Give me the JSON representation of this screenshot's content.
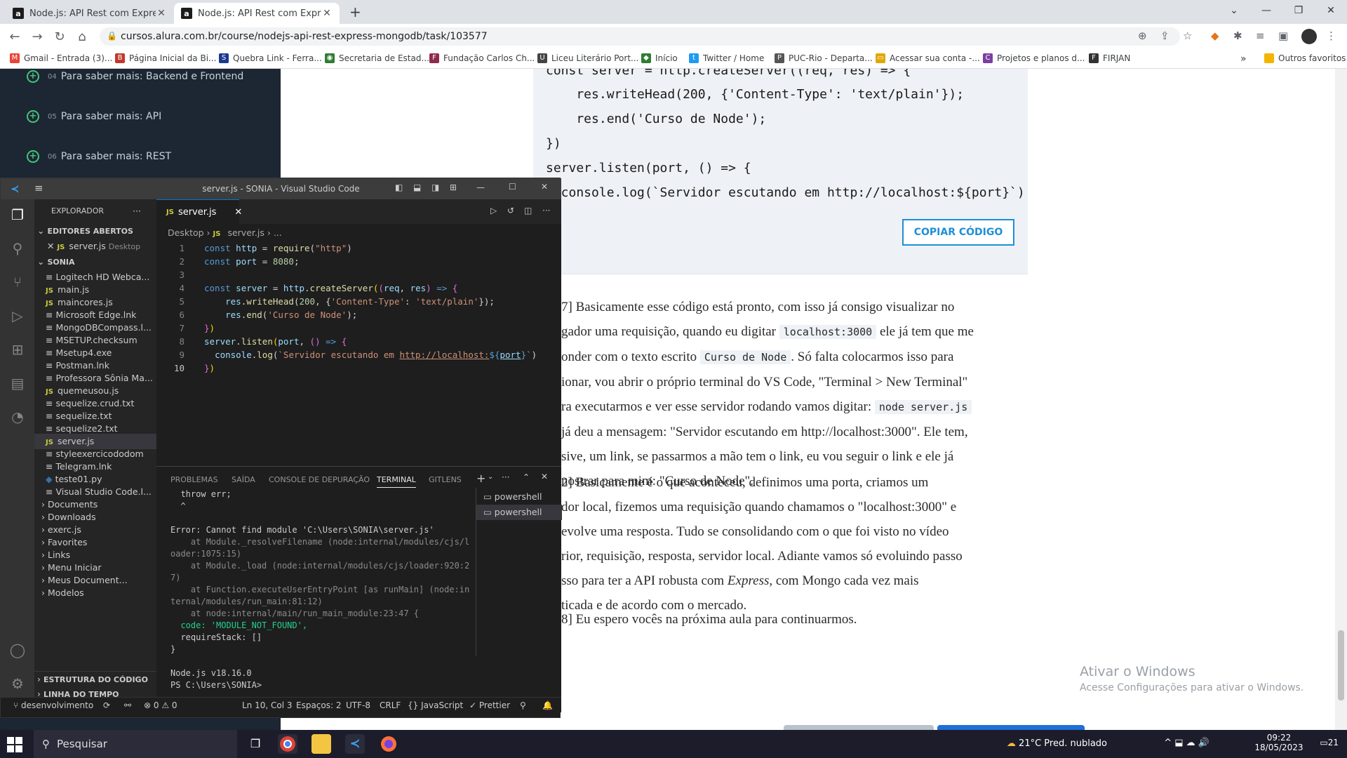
{
  "browser": {
    "tabs": [
      {
        "title": "Node.js: API Rest com Express e",
        "favicon": "a"
      },
      {
        "title": "Node.js: API Rest com Express e",
        "favicon": "a"
      }
    ],
    "new_tab": "+",
    "url": "cursos.alura.com.br/course/nodejs-api-rest-express-mongodb/task/103577",
    "bookmarks": [
      "Gmail - Entrada (3)...",
      "Página Inicial da Bi...",
      "Quebra Link - Ferra...",
      "Secretaria de Estad...",
      "Fundação Carlos Ch...",
      "Liceu Literário Port...",
      "Início",
      "Twitter / Home",
      "PUC-Rio - Departa...",
      "Acessar sua conta -...",
      "Projetos e planos d...",
      "FIRJAN"
    ],
    "bookmarks_more": "»",
    "other_bookmarks": "Outros favoritos"
  },
  "course_sidebar": {
    "lessons": [
      {
        "num": "04",
        "label": "Para saber mais: Backend e Frontend"
      },
      {
        "num": "05",
        "label": "Para saber mais: API"
      },
      {
        "num": "06",
        "label": "Para saber mais: REST"
      }
    ]
  },
  "article": {
    "code_lines": [
      "const server = http.createServer((req, res) => {",
      "    res.writeHead(200, {'Content-Type': 'text/plain'});",
      "    res.end('Curso de Node');",
      "})",
      "server.listen(port, () => {",
      "  console.log(`Servidor escutando em http://localhost:${port}`)"
    ],
    "copy_button": "COPIAR CÓDIGO",
    "p1": {
      "a": "7] Basicamente esse código está pronto, com isso já consigo visualizar no",
      "b": "gador uma requisição, quando eu digitar",
      "code1": "localhost:3000",
      "c": "ele já tem que me",
      "d": "onder com o texto escrito",
      "code2": "Curso de Node",
      "e": ". Só falta colocarmos isso para",
      "f": "ionar, vou abrir o próprio terminal do VS Code, \"Terminal > New Terminal\"",
      "g": "ra executarmos e ver esse servidor rodando vamos digitar:",
      "code3": "node server.js",
      "h": "já deu a mensagem: \"Servidor escutando em http://localhost:3000\". Ele tem,",
      "i": "sive, um link, se passarmos a mão tem o link, eu vou seguir o link e ele já",
      "j": "nostrar para mim: \"Curso de Node\"."
    },
    "p2": [
      "2] Basicamente é o que aconteceu, definimos uma porta, criamos um",
      "dor local, fizemos uma requisição quando chamamos o \"localhost:3000\" e",
      "evolve uma resposta. Tudo se consolidando com o que foi visto no vídeo",
      "rior, requisição, resposta, servidor local. Adiante vamos só evoluindo passo",
      "sso para ter a API robusta com",
      "Express",
      ", com Mongo cada vez mais",
      "ticada e de acordo com o mercado."
    ],
    "p3": "8] Eu espero vocês na próxima aula para continuarmos.",
    "watermark_title": "Ativar o Windows",
    "watermark_sub": "Acesse Configurações para ativar o Windows."
  },
  "vscode": {
    "title": "server.js - SONIA - Visual Studio Code",
    "explorer_title": "EXPLORADOR",
    "open_editors": "EDITORES ABERTOS",
    "open_file": "server.js",
    "open_file_dir": "Desktop",
    "folder": "SONIA",
    "files": [
      {
        "name": "Logitech HD Webca...",
        "type": "file"
      },
      {
        "name": "main.js",
        "type": "js"
      },
      {
        "name": "maincores.js",
        "type": "js"
      },
      {
        "name": "Microsoft Edge.lnk",
        "type": "file"
      },
      {
        "name": "MongoDBCompass.l...",
        "type": "file"
      },
      {
        "name": "MSETUP.checksum",
        "type": "file"
      },
      {
        "name": "Msetup4.exe",
        "type": "file"
      },
      {
        "name": "Postman.lnk",
        "type": "file"
      },
      {
        "name": "Professora Sônia Ma...",
        "type": "file"
      },
      {
        "name": "quemeusou.js",
        "type": "js"
      },
      {
        "name": "sequelize.crud.txt",
        "type": "file"
      },
      {
        "name": "sequelize.txt",
        "type": "file"
      },
      {
        "name": "sequelize2.txt",
        "type": "file"
      },
      {
        "name": "server.js",
        "type": "js"
      },
      {
        "name": "styleexercicododom",
        "type": "file"
      },
      {
        "name": "Telegram.lnk",
        "type": "file"
      },
      {
        "name": "teste01.py",
        "type": "py"
      },
      {
        "name": "Visual Studio Code.l...",
        "type": "file"
      }
    ],
    "folders": [
      "Documents",
      "Downloads",
      "exerc.js",
      "Favorites",
      "Links",
      "Menu Iniciar",
      "Meus Document...",
      "Modelos"
    ],
    "outline": "ESTRUTURA DO CÓDIGO",
    "timeline": "LINHA DO TEMPO",
    "tab": "server.js",
    "breadcrumb_root": "Desktop",
    "breadcrumb_file": "server.js",
    "breadcrumb_more": "...",
    "line_numbers": [
      "1",
      "2",
      "3",
      "4",
      "5",
      "6",
      "7",
      "8",
      "9",
      "10"
    ],
    "panel_tabs": [
      "PROBLEMAS",
      "SAÍDA",
      "CONSOLE DE DEPURAÇÃO",
      "TERMINAL",
      "GITLENS"
    ],
    "terminal": [
      "  throw err;",
      "  ^",
      "",
      "Error: Cannot find module 'C:\\Users\\SONIA\\server.js'",
      "    at Module._resolveFilename (node:internal/modules/cjs/l",
      "oader:1075:15)",
      "    at Module._load (node:internal/modules/cjs/loader:920:2",
      "7)",
      "    at Function.executeUserEntryPoint [as runMain] (node:in",
      "ternal/modules/run_main:81:12)",
      "    at node:internal/main/run_main_module:23:47 {",
      "  code: 'MODULE_NOT_FOUND',",
      "  requireStack: []",
      "}",
      "",
      "Node.js v18.16.0",
      "PS C:\\Users\\SONIA> "
    ],
    "terminals": [
      "powershell",
      "powershell"
    ],
    "status": {
      "branch": "desenvolvimento",
      "errors": "0",
      "warnings": "0",
      "position": "Ln 10, Col 3",
      "spaces": "Espaços: 2",
      "encoding": "UTF-8",
      "eol": "CRLF",
      "language": "JavaScript",
      "prettier": "Prettier"
    }
  },
  "taskbar": {
    "search": "Pesquisar",
    "weather": "21°C  Pred. nublado",
    "time": "09:22",
    "date": "18/05/2023",
    "notifications": "21"
  }
}
